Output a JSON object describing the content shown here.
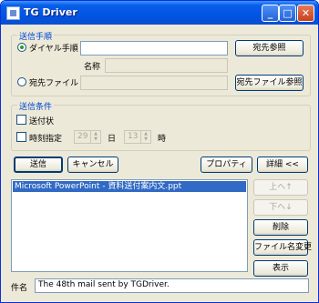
{
  "window": {
    "title": "TG Driver",
    "controls": {
      "minimize": "_",
      "maximize": "□",
      "close": "✕"
    }
  },
  "send_method": {
    "legend": "送信手順",
    "dial_label": "ダイヤル手順",
    "dial_value": "",
    "dest_browse_button": "宛先参照",
    "name_label": "名称",
    "name_value": "",
    "dest_file_label": "宛先ファイル",
    "dest_file_value": "",
    "dest_file_browse_button": "宛先ファイル参照",
    "selected": "dial"
  },
  "send_conditions": {
    "legend": "送信条件",
    "cover_label": "送付状",
    "time_label": "時刻指定",
    "day_value": "29",
    "day_unit": "日",
    "hour_value": "13",
    "hour_unit": "時"
  },
  "actions": {
    "send_button": "送信",
    "cancel_button": "キャンセル",
    "properties_button": "プロパティ",
    "details_button": "詳細 <<"
  },
  "file_list": {
    "items": [
      "Microsoft PowerPoint - 資料送付案内文.ppt"
    ]
  },
  "list_buttons": {
    "up": "上へ↑",
    "down": "下へ↓",
    "delete": "削除",
    "rename": "ファイル名変更",
    "view": "表示"
  },
  "subject": {
    "label": "件名",
    "value": "The 48th mail sent by TGDriver."
  }
}
